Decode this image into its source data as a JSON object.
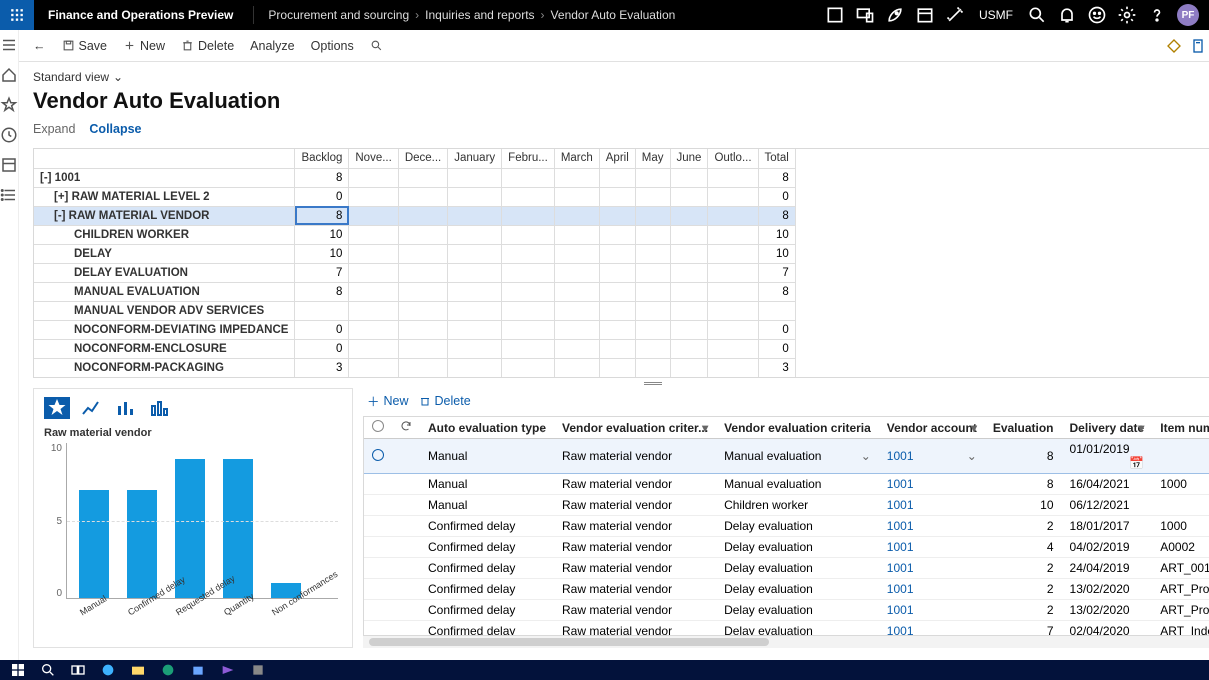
{
  "navbar": {
    "brand": "Finance and Operations Preview",
    "breadcrumb": [
      "Procurement and sourcing",
      "Inquiries and reports",
      "Vendor Auto Evaluation"
    ],
    "company": "USMF",
    "avatar": "PF"
  },
  "actionbar": {
    "back": "←",
    "save": "Save",
    "new": "New",
    "delete": "Delete",
    "analyze": "Analyze",
    "options": "Options"
  },
  "page": {
    "view_label": "Standard view",
    "title": "Vendor Auto Evaluation",
    "expand": "Expand",
    "collapse": "Collapse"
  },
  "tree_grid": {
    "headers": [
      "",
      "Backlog",
      "Nove...",
      "Dece...",
      "January",
      "Febru...",
      "March",
      "April",
      "May",
      "June",
      "Outlo...",
      "Total"
    ],
    "rows": [
      {
        "label": "[-] 1001",
        "indent": 0,
        "backlog": "8",
        "total": "8",
        "selected": false
      },
      {
        "label": "[+] RAW MATERIAL LEVEL 2",
        "indent": 1,
        "backlog": "0",
        "total": "0",
        "selected": false
      },
      {
        "label": "[-] RAW MATERIAL VENDOR",
        "indent": 1,
        "backlog": "8",
        "total": "8",
        "selected": true,
        "cellsel": true
      },
      {
        "label": "CHILDREN WORKER",
        "indent": 3,
        "backlog": "10",
        "total": "10"
      },
      {
        "label": "DELAY",
        "indent": 3,
        "backlog": "10",
        "total": "10"
      },
      {
        "label": "DELAY EVALUATION",
        "indent": 3,
        "backlog": "7",
        "total": "7"
      },
      {
        "label": "MANUAL EVALUATION",
        "indent": 3,
        "backlog": "8",
        "total": "8"
      },
      {
        "label": "MANUAL VENDOR ADV SERVICES",
        "indent": 3,
        "backlog": "",
        "total": ""
      },
      {
        "label": "NOCONFORM-DEVIATING IMPEDANCE",
        "indent": 3,
        "backlog": "0",
        "total": "0"
      },
      {
        "label": "NOCONFORM-ENCLOSURE",
        "indent": 3,
        "backlog": "0",
        "total": "0"
      },
      {
        "label": "NOCONFORM-PACKAGING",
        "indent": 3,
        "backlog": "3",
        "total": "3"
      }
    ]
  },
  "chart_data": {
    "type": "bar",
    "title": "Raw material vendor",
    "categories": [
      "Manual",
      "Confirmed delay",
      "Requested delay",
      "Quantity",
      "Non conformances"
    ],
    "values": [
      7,
      7,
      9,
      9,
      1
    ],
    "ylim": [
      0,
      10
    ],
    "yticks": [
      0,
      5,
      10
    ],
    "xlabel": "",
    "ylabel": ""
  },
  "details": {
    "toolbar": {
      "new": "New",
      "delete": "Delete"
    },
    "headers": [
      "",
      "",
      "Auto evaluation type",
      "Vendor evaluation criter...",
      "Vendor evaluation criteria",
      "Vendor account",
      "Evaluation",
      "Delivery date",
      "Item numbe"
    ],
    "rows": [
      {
        "sel": true,
        "type": "Manual",
        "grp": "Raw material vendor",
        "crit": "Manual evaluation",
        "acct": "1001",
        "eval": "8",
        "date": "01/01/2019",
        "item": ""
      },
      {
        "sel": false,
        "type": "Manual",
        "grp": "Raw material vendor",
        "crit": "Manual evaluation",
        "acct": "1001",
        "eval": "8",
        "date": "16/04/2021",
        "item": "1000"
      },
      {
        "sel": false,
        "type": "Manual",
        "grp": "Raw material vendor",
        "crit": "Children worker",
        "acct": "1001",
        "eval": "10",
        "date": "06/12/2021",
        "item": ""
      },
      {
        "sel": false,
        "type": "Confirmed delay",
        "grp": "Raw material vendor",
        "crit": "Delay evaluation",
        "acct": "1001",
        "eval": "2",
        "date": "18/01/2017",
        "item": "1000"
      },
      {
        "sel": false,
        "type": "Confirmed delay",
        "grp": "Raw material vendor",
        "crit": "Delay evaluation",
        "acct": "1001",
        "eval": "4",
        "date": "04/02/2019",
        "item": "A0002"
      },
      {
        "sel": false,
        "type": "Confirmed delay",
        "grp": "Raw material vendor",
        "crit": "Delay evaluation",
        "acct": "1001",
        "eval": "2",
        "date": "24/04/2019",
        "item": "ART_001"
      },
      {
        "sel": false,
        "type": "Confirmed delay",
        "grp": "Raw material vendor",
        "crit": "Delay evaluation",
        "acct": "1001",
        "eval": "2",
        "date": "13/02/2020",
        "item": "ART_Project"
      },
      {
        "sel": false,
        "type": "Confirmed delay",
        "grp": "Raw material vendor",
        "crit": "Delay evaluation",
        "acct": "1001",
        "eval": "2",
        "date": "13/02/2020",
        "item": "ART_Project"
      },
      {
        "sel": false,
        "type": "Confirmed delay",
        "grp": "Raw material vendor",
        "crit": "Delay evaluation",
        "acct": "1001",
        "eval": "7",
        "date": "02/04/2020",
        "item": "ART_Index_C"
      }
    ]
  }
}
